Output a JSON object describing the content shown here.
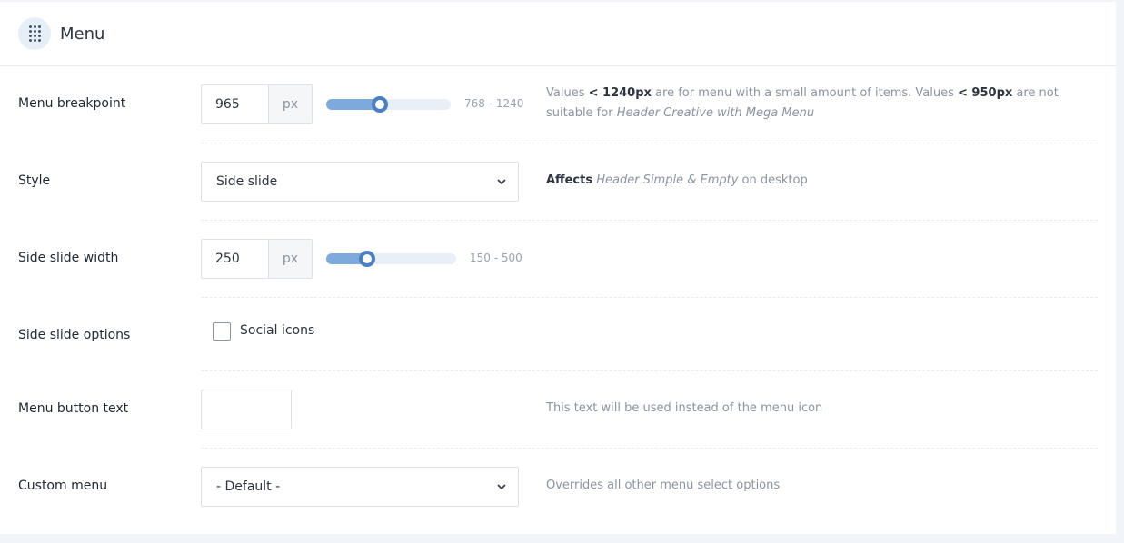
{
  "header": {
    "title": "Menu",
    "icon": "drag-grip-icon"
  },
  "breakpoint": {
    "label": "Menu breakpoint",
    "value": "965",
    "unit": "px",
    "range_text": "768 - 1240",
    "slider_min": 768,
    "slider_max": 1240,
    "slider_value": 965,
    "desc": {
      "t1": "Values ",
      "b1": "< 1240px",
      "t2": " are for menu with a small amount of items. Values ",
      "b2": "< 950px",
      "t3": " are not suitable for ",
      "i1": "Header Creative with Mega Menu"
    }
  },
  "style": {
    "label": "Style",
    "selected": "Side slide",
    "desc": {
      "b1": "Affects",
      "i1": "Header Simple & Empty",
      "t1": " on desktop"
    }
  },
  "side_width": {
    "label": "Side slide width",
    "value": "250",
    "unit": "px",
    "range_text": "150 - 500",
    "slider_min": 150,
    "slider_max": 500,
    "slider_value": 250
  },
  "side_options": {
    "label": "Side slide options",
    "checkbox_label": "Social icons",
    "checked": false
  },
  "menu_button": {
    "label": "Menu button text",
    "value": "",
    "desc": "This text will be used instead of the menu icon"
  },
  "custom_menu": {
    "label": "Custom menu",
    "selected": "- Default -",
    "desc": "Overrides all other menu select options"
  },
  "colors": {
    "accent": "#4b7fc4",
    "slider_fill": "#7ea9dc",
    "track": "#e8eff7"
  }
}
